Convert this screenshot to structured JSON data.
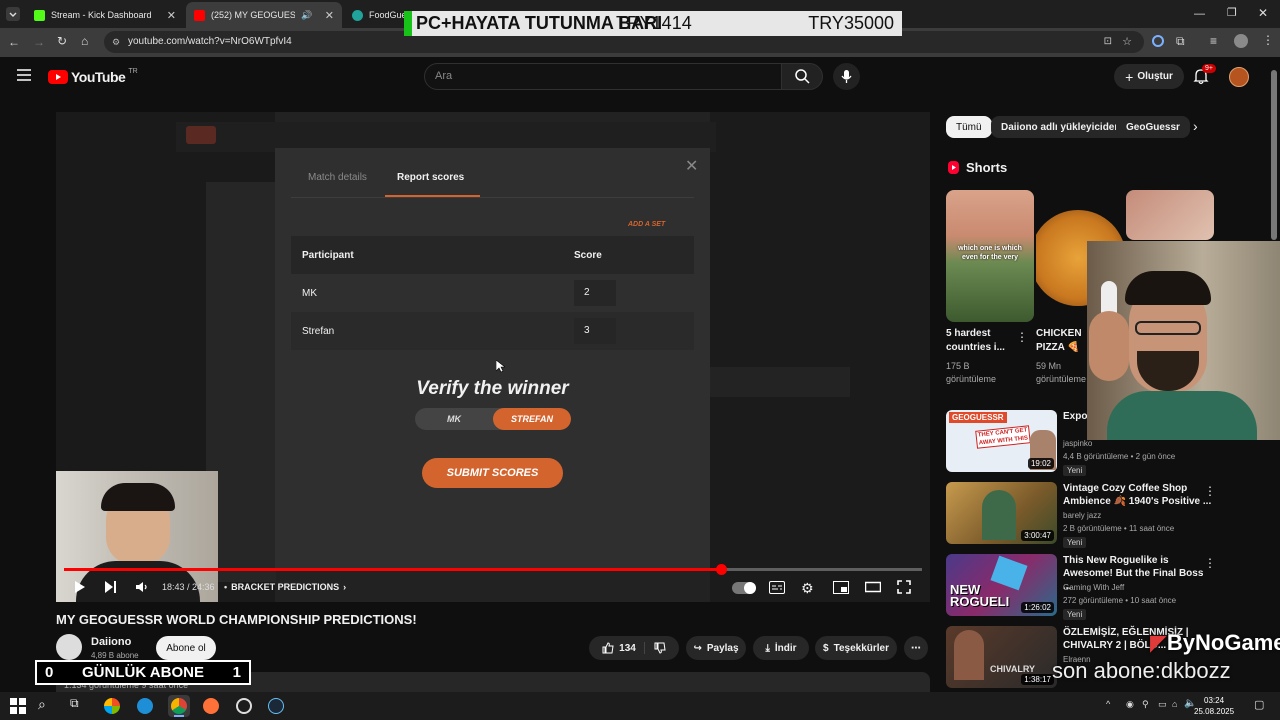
{
  "browser": {
    "tabs": [
      {
        "label": "Stream - Kick Dashboard",
        "color": "#53fc18"
      },
      {
        "label": "(252) MY GEOGUESSR WOR",
        "color": "#ff0000"
      },
      {
        "label": "FoodGuess",
        "color": "#1fa39a"
      }
    ],
    "url": "youtube.com/watch?v=NrO6WTpfvI4"
  },
  "stream_banner": {
    "left": "PC+HAYATA TUTUNMA BARI",
    "mid": "TRY1414",
    "right": "TRY35000"
  },
  "youtube": {
    "logo_text": "YouTube",
    "region": "TR",
    "search_placeholder": "Ara",
    "create_label": "Oluştur",
    "notif_count": "9+"
  },
  "modal": {
    "tabs": [
      "Match details",
      "Report scores"
    ],
    "add_set": "ADD A SET",
    "col_participant": "Participant",
    "col_score": "Score",
    "rows": [
      {
        "name": "MK",
        "score": "2"
      },
      {
        "name": "Strefan",
        "score": "3"
      }
    ],
    "verify_title": "Verify the winner",
    "toggle": [
      "MK",
      "STREFAN"
    ],
    "submit_label": "SUBMIT SCORES"
  },
  "player": {
    "time": "18:43 / 24:36",
    "chapter": "BRACKET PREDICTIONS",
    "progress": 0.766
  },
  "video": {
    "title": "MY GEOGUESSR WORLD CHAMPIONSHIP PREDICTIONS!",
    "channel": "Daiiono",
    "subs": "4,89 B abone",
    "subscribe_label": "Abone ol",
    "likes": "134",
    "share": "Paylaş",
    "download": "İndir",
    "thanks": "Teşekkürler",
    "views": "1.134 görüntüleme  9 saat önce"
  },
  "daily_sub": {
    "left": "0",
    "label": "GÜNLÜK ABONE",
    "right": "1"
  },
  "sidebar": {
    "chips": [
      "Tümü",
      "Daiiono adlı yükleyiciden",
      "GeoGuessr"
    ],
    "shorts_title": "Shorts",
    "shorts": [
      {
        "title": "5 hardest countries i...",
        "views": "175 B",
        "views2": "görüntüleme",
        "caption": "which one is which even for the very"
      },
      {
        "title": "CHICKEN PIZZA 🍕",
        "views": "59 Mn",
        "views2": "görüntüleme"
      }
    ],
    "videos": [
      {
        "title": "Expos... Audec...",
        "channel": "jaspinko",
        "meta": "4,4 B görüntüleme • 2 gün önce",
        "badge": "Yeni",
        "duration": "19:02",
        "thumb_text": "THEY CAN'T GET AWAY WITH THIS",
        "thumb_logo": "GEOGUESSR"
      },
      {
        "title": "Vintage Cozy Coffee Shop Ambience 🍂 1940's Positive ...",
        "channel": "barely jazz",
        "meta": "2 B görüntüleme • 11 saat önce",
        "badge": "Yeni",
        "duration": "3:00:47"
      },
      {
        "title": "This New Roguelike is Awesome! But the Final Boss ...",
        "channel": "Gaming With Jeff",
        "meta": "272 görüntüleme • 10 saat önce",
        "badge": "Yeni",
        "duration": "1:26:02",
        "thumb_text": "NEW ROGUELI"
      },
      {
        "title": "ÖZLEMİŞİZ, EĞLENMİŞİZ | CHIVALRY 2 | BÖLÜ...",
        "channel": "Elraenn",
        "meta": "",
        "duration": "1:38:17",
        "thumb_text": "CHIVALRY"
      }
    ]
  },
  "overlays": {
    "bynogame": "ByNoGame",
    "son_abone": "son abone:dkbozz"
  },
  "taskbar": {
    "time": "03:24",
    "date": "25.08.2025"
  }
}
